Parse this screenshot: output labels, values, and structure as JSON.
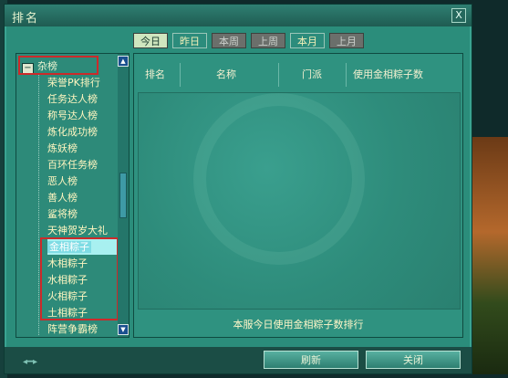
{
  "window": {
    "title": "排名",
    "close_label": "X"
  },
  "tabs": [
    {
      "label": "今日",
      "state": "active"
    },
    {
      "label": "昨日",
      "state": "bright"
    },
    {
      "label": "本周",
      "state": "disabled"
    },
    {
      "label": "上周",
      "state": "disabled"
    },
    {
      "label": "本月",
      "state": "bright"
    },
    {
      "label": "上月",
      "state": "disabled"
    }
  ],
  "sidebar": {
    "category_label": "杂榜",
    "items": [
      "荣誉PK排行",
      "任务达人榜",
      "称号达人榜",
      "炼化成功榜",
      "炼妖榜",
      "百环任务榜",
      "恶人榜",
      "善人榜",
      "鲨将榜",
      "天神贺岁大礼",
      "金相粽子",
      "木相粽子",
      "水相粽子",
      "火相粽子",
      "土相粽子",
      "阵营争霸榜"
    ],
    "selected_index": 10
  },
  "table": {
    "columns": [
      "排名",
      "名称",
      "门派",
      "使用金相粽子数"
    ]
  },
  "footer_text": "本服今日使用金相粽子数排行",
  "buttons": {
    "refresh": "刷新",
    "close": "关闭"
  },
  "colors": {
    "panel": "#2b8d7b",
    "highlight": "#cc2a2a",
    "text": "#fff6c0"
  }
}
